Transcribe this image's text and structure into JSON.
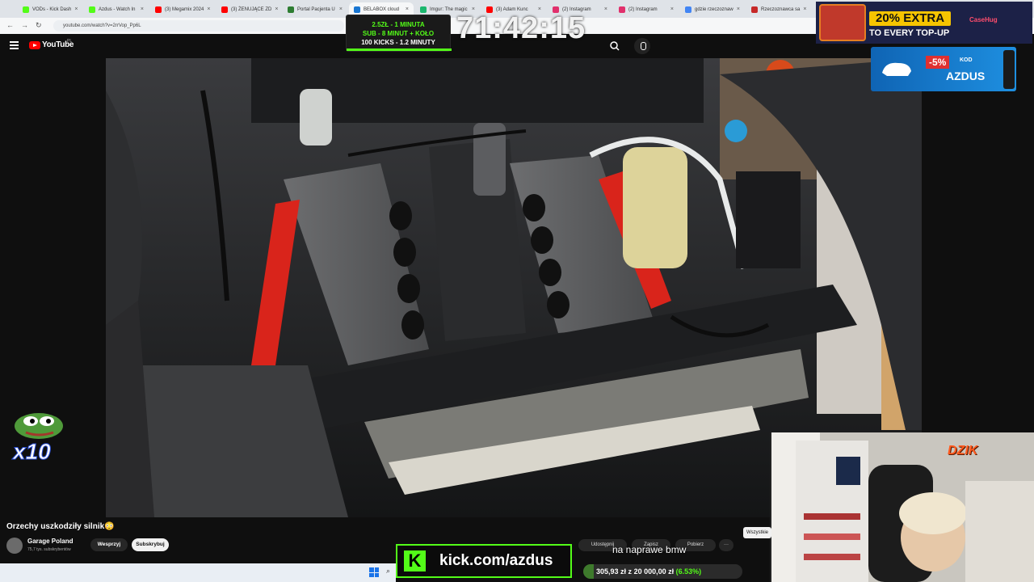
{
  "browser": {
    "tabs": [
      {
        "label": "VODs - Kick Dash",
        "color": "#53fc18"
      },
      {
        "label": "Azdus - Watch In",
        "color": "#53fc18"
      },
      {
        "label": "(3) Megamix 2024",
        "color": "#ff0000"
      },
      {
        "label": "(3) ŻENUJĄCE ZD",
        "color": "#ff0000"
      },
      {
        "label": "Portal Pacjenta U",
        "color": "#2e7d32"
      },
      {
        "label": "BELABOX cloud",
        "color": "#1976d2"
      },
      {
        "label": "Imgur: The magic",
        "color": "#1bb76e"
      },
      {
        "label": "(3) Adam Kunc",
        "color": "#ff0000"
      },
      {
        "label": "(2) Instagram",
        "color": "#e1306c"
      },
      {
        "label": "(2) Instagram",
        "color": "#e1306c"
      },
      {
        "label": "gdzie rzeczoznaw",
        "color": "#4285f4"
      },
      {
        "label": "Rzeczoznawca sa",
        "color": "#c62828"
      }
    ],
    "url": "youtube.com/watch?v=2rrVop_Pp6L"
  },
  "youtube": {
    "logo_text": "YouTube",
    "region": "PL",
    "video_title": "Orzechy uszkodziły silnik😳",
    "channel_name": "Garage Poland",
    "channel_subs": "75,7 tys. subskrybentów",
    "support_label": "Wesprzyj",
    "subscribe_label": "Subskrybuj",
    "share_label": "Udostępnij",
    "save_label": "Zapisz",
    "download_label": "Pobierz",
    "more_label": "···",
    "all_tab_label": "Wszystkie"
  },
  "overlay": {
    "timer_rows": [
      "2.5ZŁ - 1 MINUTA",
      "SUB - 8 MINUT + KOŁO",
      "100 KICKS - 1.2 MINUTY"
    ],
    "big_timer": "71:42:15",
    "casehug_extra": "20% EXTRA",
    "casehug_sub": "TO EVERY TOP-UP",
    "casehug_brand": "CaseHug",
    "promo_discount": "-5%",
    "promo_kod": "KOD",
    "promo_code": "AZDUS",
    "emote_count": "x10",
    "caption": "na naprawe bmw",
    "kick_letter": "K",
    "kick_url": "kick.com/azdus",
    "donation_current": "305,93 zł",
    "donation_goal": "20 000,00 zł",
    "donation_percent": "(6.53%)",
    "donation_fraction": 0.0653,
    "webcam_logo": "DZIK"
  },
  "colors": {
    "kick_green": "#53fc18",
    "youtube_red": "#ff0000",
    "casehug_yellow": "#f6c400"
  }
}
